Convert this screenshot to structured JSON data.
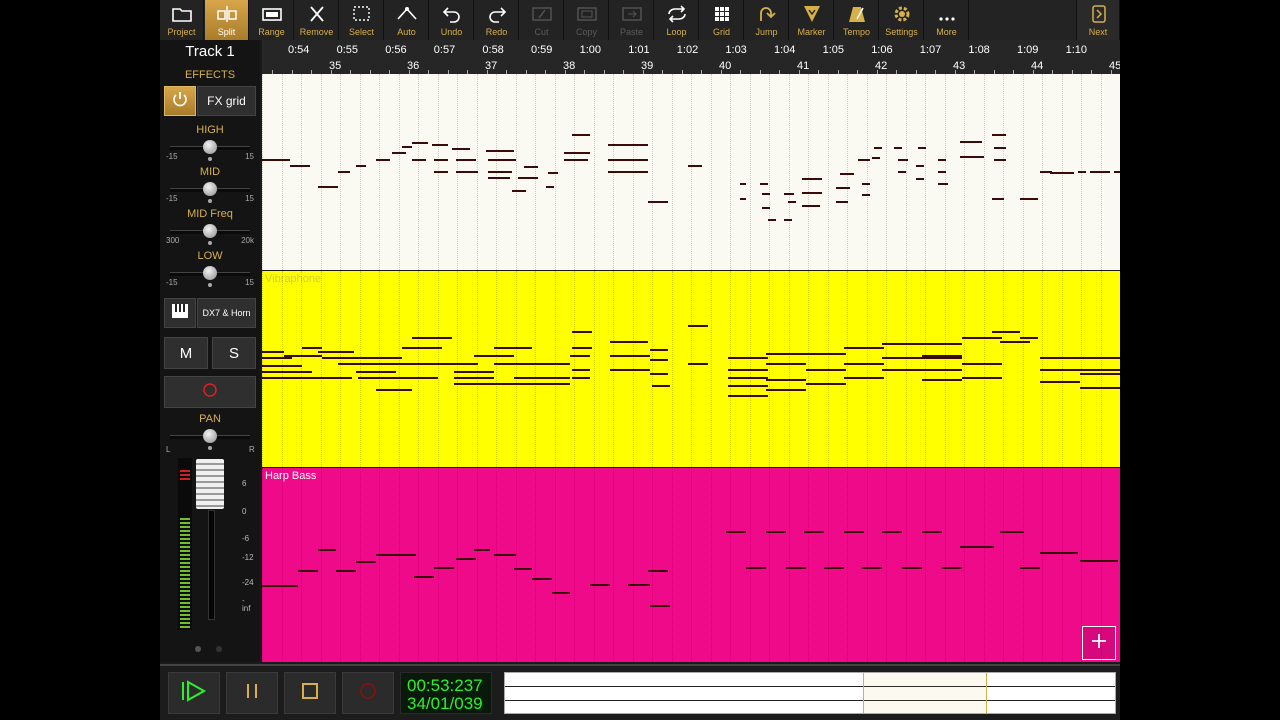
{
  "toolbar": {
    "items": [
      {
        "label": "Project",
        "icon": "folder-icon",
        "state": "normal"
      },
      {
        "label": "Split",
        "icon": "split-icon",
        "state": "active"
      },
      {
        "label": "Range",
        "icon": "range-icon",
        "state": "normal"
      },
      {
        "label": "Remove",
        "icon": "remove-icon",
        "state": "normal"
      },
      {
        "label": "Select",
        "icon": "select-icon",
        "state": "normal"
      },
      {
        "label": "Auto",
        "icon": "automation-icon",
        "state": "normal"
      },
      {
        "label": "Undo",
        "icon": "undo-icon",
        "state": "normal"
      },
      {
        "label": "Redo",
        "icon": "redo-icon",
        "state": "normal"
      },
      {
        "label": "Cut",
        "icon": "cut-icon",
        "state": "disabled"
      },
      {
        "label": "Copy",
        "icon": "copy-icon",
        "state": "disabled"
      },
      {
        "label": "Paste",
        "icon": "paste-icon",
        "state": "disabled"
      },
      {
        "label": "Loop",
        "icon": "loop-icon",
        "state": "normal"
      },
      {
        "label": "Grid",
        "icon": "grid-icon",
        "state": "normal"
      },
      {
        "label": "Jump",
        "icon": "jump-icon",
        "state": "normal"
      },
      {
        "label": "Marker",
        "icon": "marker-icon",
        "state": "normal"
      },
      {
        "label": "Tempo",
        "icon": "metronome-icon",
        "state": "normal"
      },
      {
        "label": "Settings",
        "icon": "gear-icon",
        "state": "normal"
      },
      {
        "label": "More",
        "icon": "more-icon",
        "state": "normal"
      }
    ],
    "next_label": "Next"
  },
  "track": {
    "name": "Track 1",
    "effects_label": "EFFECTS",
    "fx_button": "FX grid",
    "eq": [
      {
        "label": "HIGH",
        "min": "-15",
        "max": "15",
        "value": 0.5
      },
      {
        "label": "MID",
        "min": "-15",
        "max": "15",
        "value": 0.5
      },
      {
        "label": "MID Freq",
        "min": "300",
        "max": "20k",
        "value": 0.5
      },
      {
        "label": "LOW",
        "min": "-15",
        "max": "15",
        "value": 0.5
      }
    ],
    "instrument": "DX7 & Horn",
    "mute": "M",
    "solo": "S",
    "pan_label": "PAN",
    "pan_left": "L",
    "pan_right": "R",
    "pan_value": 0.5,
    "meter_scale": [
      "6",
      "0",
      "-6",
      "-12",
      "-24",
      "-inf"
    ]
  },
  "ruler": {
    "times": [
      "0:54",
      "0:55",
      "0:56",
      "0:57",
      "0:58",
      "0:59",
      "1:00",
      "1:01",
      "1:02",
      "1:03",
      "1:04",
      "1:05",
      "1:06",
      "1:07",
      "1:08",
      "1:09",
      "1:10"
    ],
    "bars": [
      "35",
      "36",
      "37",
      "38",
      "39",
      "40",
      "41",
      "42",
      "43",
      "44",
      "45"
    ]
  },
  "lanes": [
    {
      "name": "",
      "color": "#fbfaf2",
      "label_color": "#888888"
    },
    {
      "name": "Vibraphone",
      "color": "#ffff00",
      "label_color": "#cfcf3a"
    },
    {
      "name": "Harp Bass",
      "color": "#ef0a8a",
      "label_color": "#ffffff"
    }
  ],
  "transport": {
    "time": "00:53:237",
    "position": "34/01/039"
  },
  "colors": {
    "accent": "#d8b04a",
    "display": "#2cf02c"
  }
}
